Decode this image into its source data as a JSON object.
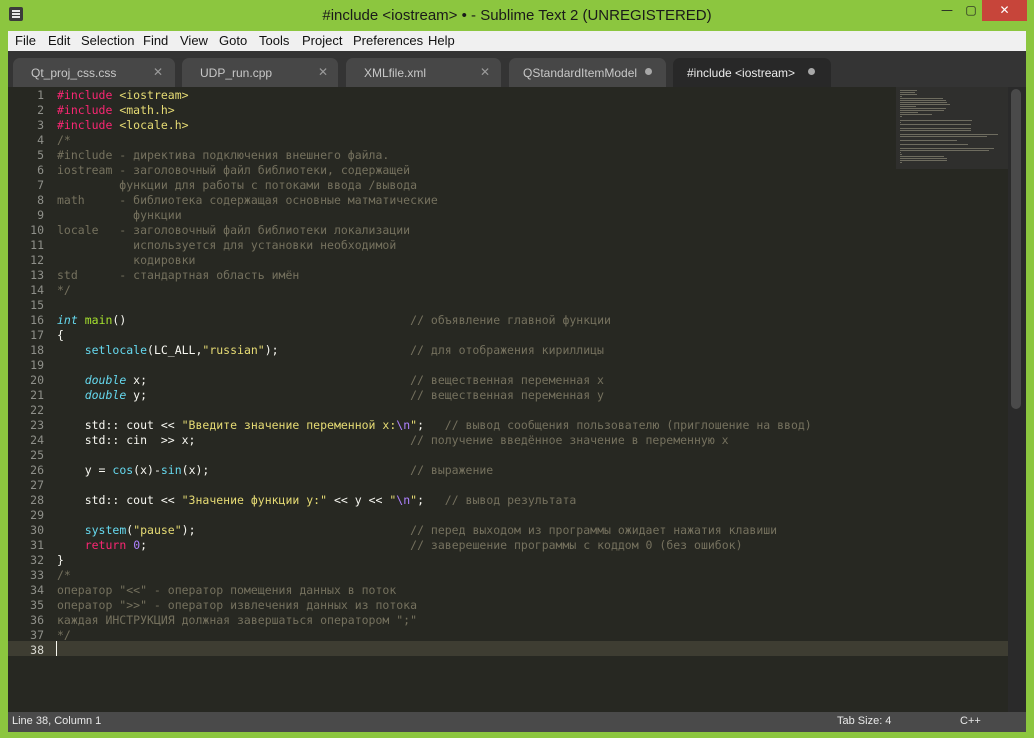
{
  "window": {
    "title": "#include <iostream> • - Sublime Text 2 (UNREGISTERED)",
    "controls": {
      "minimize": "—",
      "maximize": "▢",
      "close": "✕"
    }
  },
  "menu": [
    "File",
    "Edit",
    "Selection",
    "Find",
    "View",
    "Goto",
    "Tools",
    "Project",
    "Preferences",
    "Help"
  ],
  "tabs": [
    {
      "label": "Qt_proj_css.css",
      "state": "close"
    },
    {
      "label": "UDP_run.cpp",
      "state": "close"
    },
    {
      "label": "XMLfile.xml",
      "state": "close"
    },
    {
      "label": "QStandardItemModel",
      "state": "dirty"
    },
    {
      "label": "#include <iostream>",
      "state": "dirty",
      "active": true
    }
  ],
  "code": [
    "#include <iostream>",
    "#include <math.h>",
    "#include <locale.h>",
    "/*",
    "#include - директива подключения внешнего файла.",
    "iostream - заголовочный файл библиотеки, содержащей",
    "         функции для работы с потоками ввода /вывода",
    "math     - библиотека содержащая основные матматические",
    "           функции",
    "locale   - заголовочный файл библиотеки локализации",
    "           используется для установки необходимой",
    "           кодировки",
    "std      - стандартная область имён",
    "*/",
    "",
    "int main()                                         // объявление главной функции",
    "{",
    "    setlocale(LC_ALL,\"russian\");                   // для отображения кириллицы",
    "",
    "    double x;                                      // вещественная переменная x",
    "    double y;                                      // вещественная переменная y",
    "",
    "    std:: cout << \"Введите значение переменной x:\\n\";   // вывод сообщения пользователю (приглошение на ввод)",
    "    std:: cin  >> x;                               // получение введённое значение в переменную x",
    "",
    "    y = cos(x)-sin(x);                             // выражение",
    "",
    "    std:: cout << \"Значение функции y:\" << y << \"\\n\";   // вывод результата",
    "",
    "    system(\"pause\");                               // перед выходом из программы ожидает нажатия клавиши",
    "    return 0;                                      // заверешение программы с коддом 0 (без ошибок)",
    "}",
    "/*",
    "оператор \"<<\" - оператор помещения данных в поток",
    "оператор \">>\" - оператор извлечения данных из потока",
    "каждая ИНСТРУКЦИЯ должная завершаться оператором \";\"",
    "*/",
    ""
  ],
  "status": {
    "position": "Line 38, Column 1",
    "tab_size": "Tab Size: 4",
    "syntax": "C++"
  },
  "current_line": 38,
  "colors": {
    "window_accent": "#8cc63f",
    "editor_background": "#272822",
    "keyword": "#f92672",
    "string": "#e6db74",
    "comment": "#75715e",
    "type": "#66d9ef",
    "function": "#a6e22e",
    "number": "#ae81ff"
  }
}
